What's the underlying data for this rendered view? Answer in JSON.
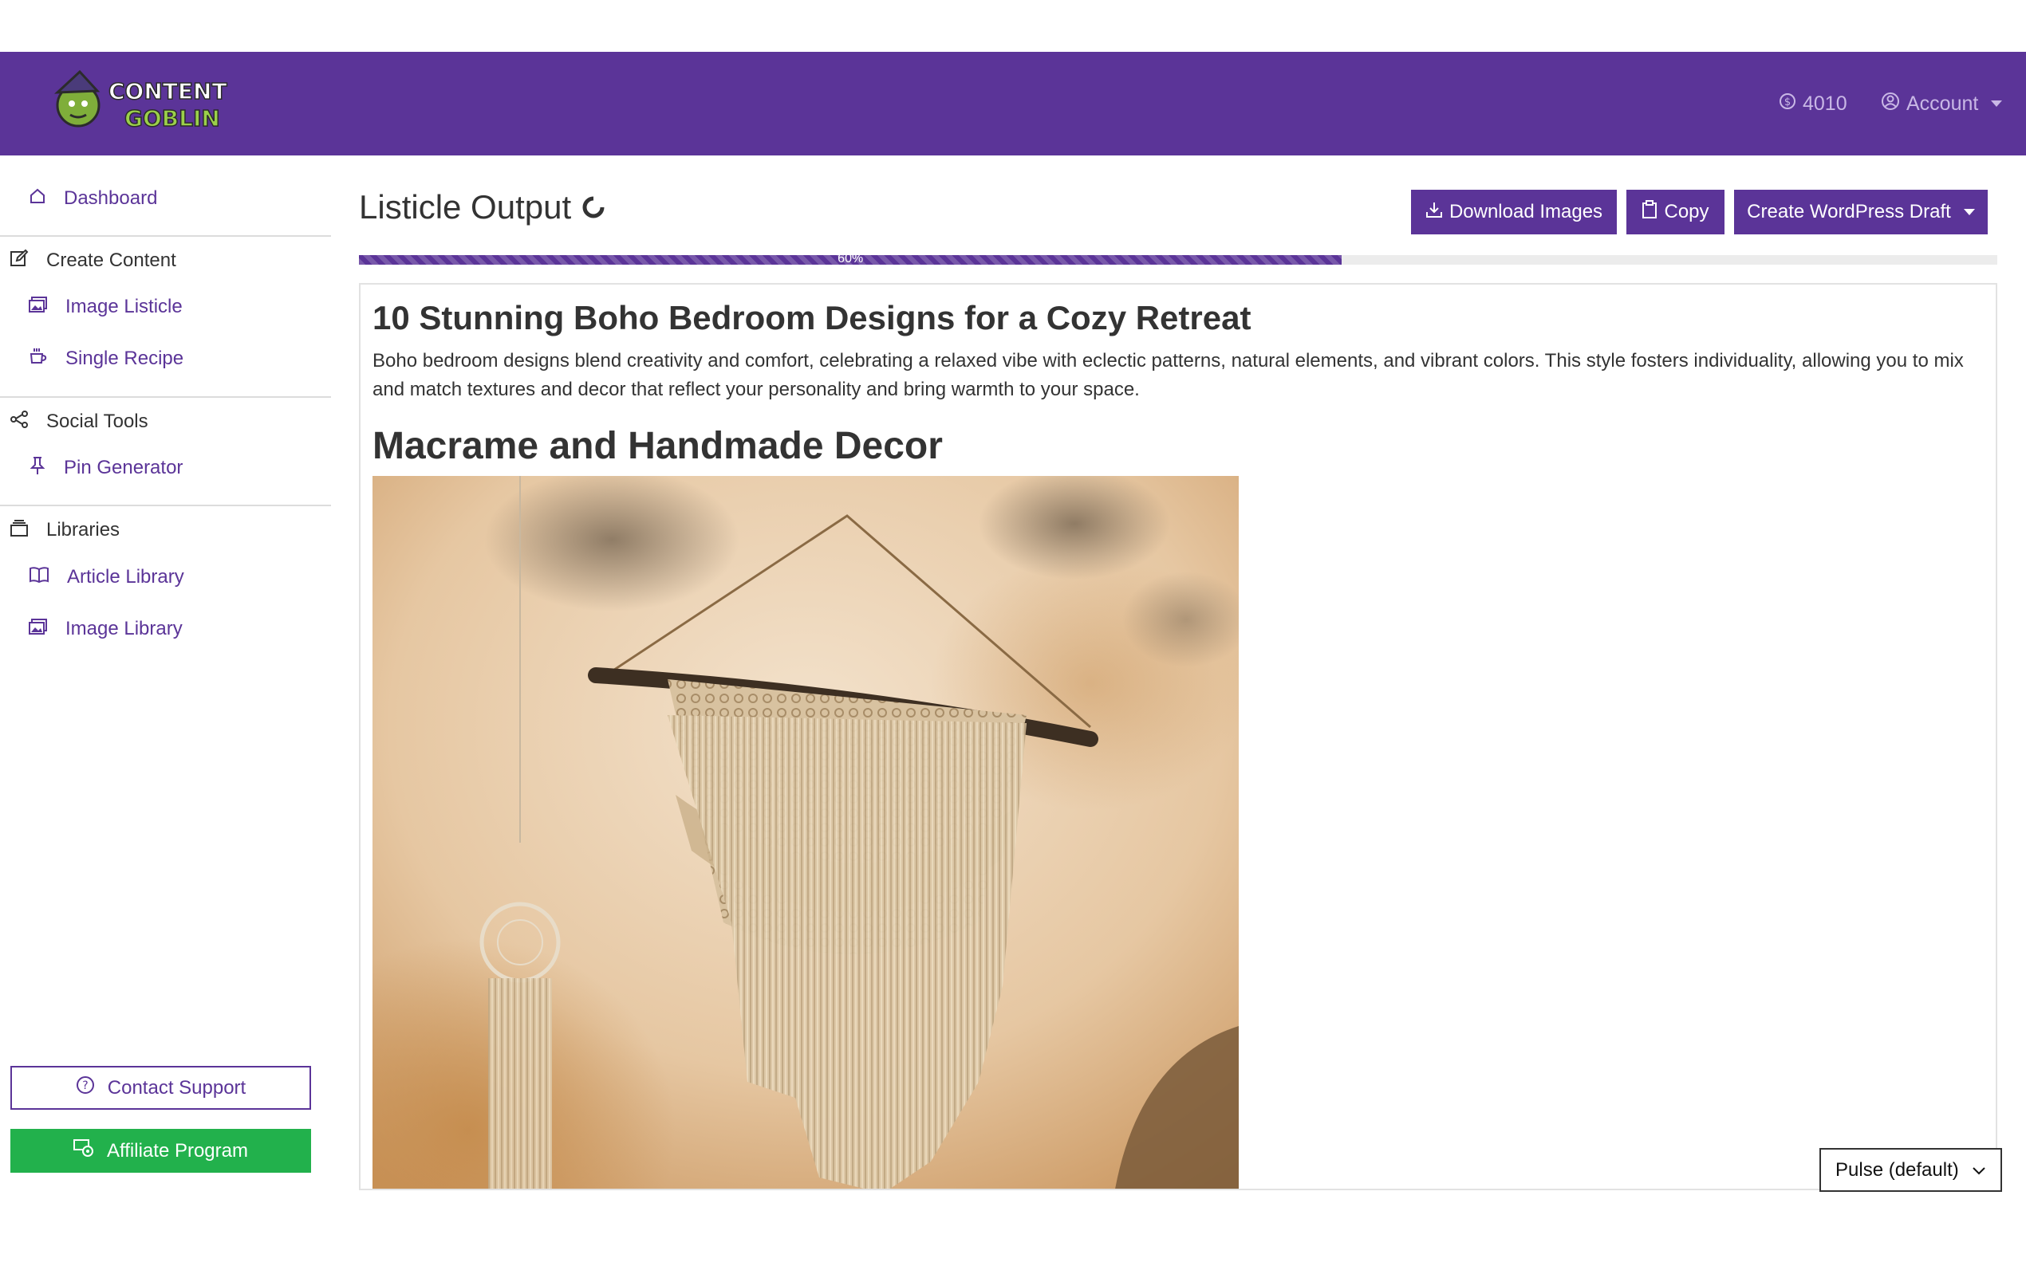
{
  "header": {
    "logo_text": "CONTENT GOBLIN",
    "credits": "4010",
    "account_label": "Account"
  },
  "sidebar": {
    "dashboard": "Dashboard",
    "create_content": "Create Content",
    "image_listicle": "Image Listicle",
    "single_recipe": "Single Recipe",
    "social_tools": "Social Tools",
    "pin_generator": "Pin Generator",
    "libraries": "Libraries",
    "article_library": "Article Library",
    "image_library": "Image Library",
    "contact_support": "Contact Support",
    "affiliate_program": "Affiliate Program"
  },
  "main": {
    "page_title": "Listicle Output",
    "download_images": "Download Images",
    "copy": "Copy",
    "create_wp_draft": "Create WordPress Draft",
    "progress": {
      "percent": 60,
      "label": "60%"
    },
    "article": {
      "title": "10 Stunning Boho Bedroom Designs for a Cozy Retreat",
      "intro": "Boho bedroom designs blend creativity and comfort, celebrating a relaxed vibe with eclectic patterns, natural elements, and vibrant colors. This style fosters individuality, allowing you to mix and match textures and decor that reflect your personality and bring warmth to your space.",
      "section_heading": "Macrame and Handmade Decor"
    }
  },
  "theme_select": {
    "value": "Pulse (default)"
  },
  "colors": {
    "brand": "#5b3498",
    "affiliate": "#22b14c"
  }
}
